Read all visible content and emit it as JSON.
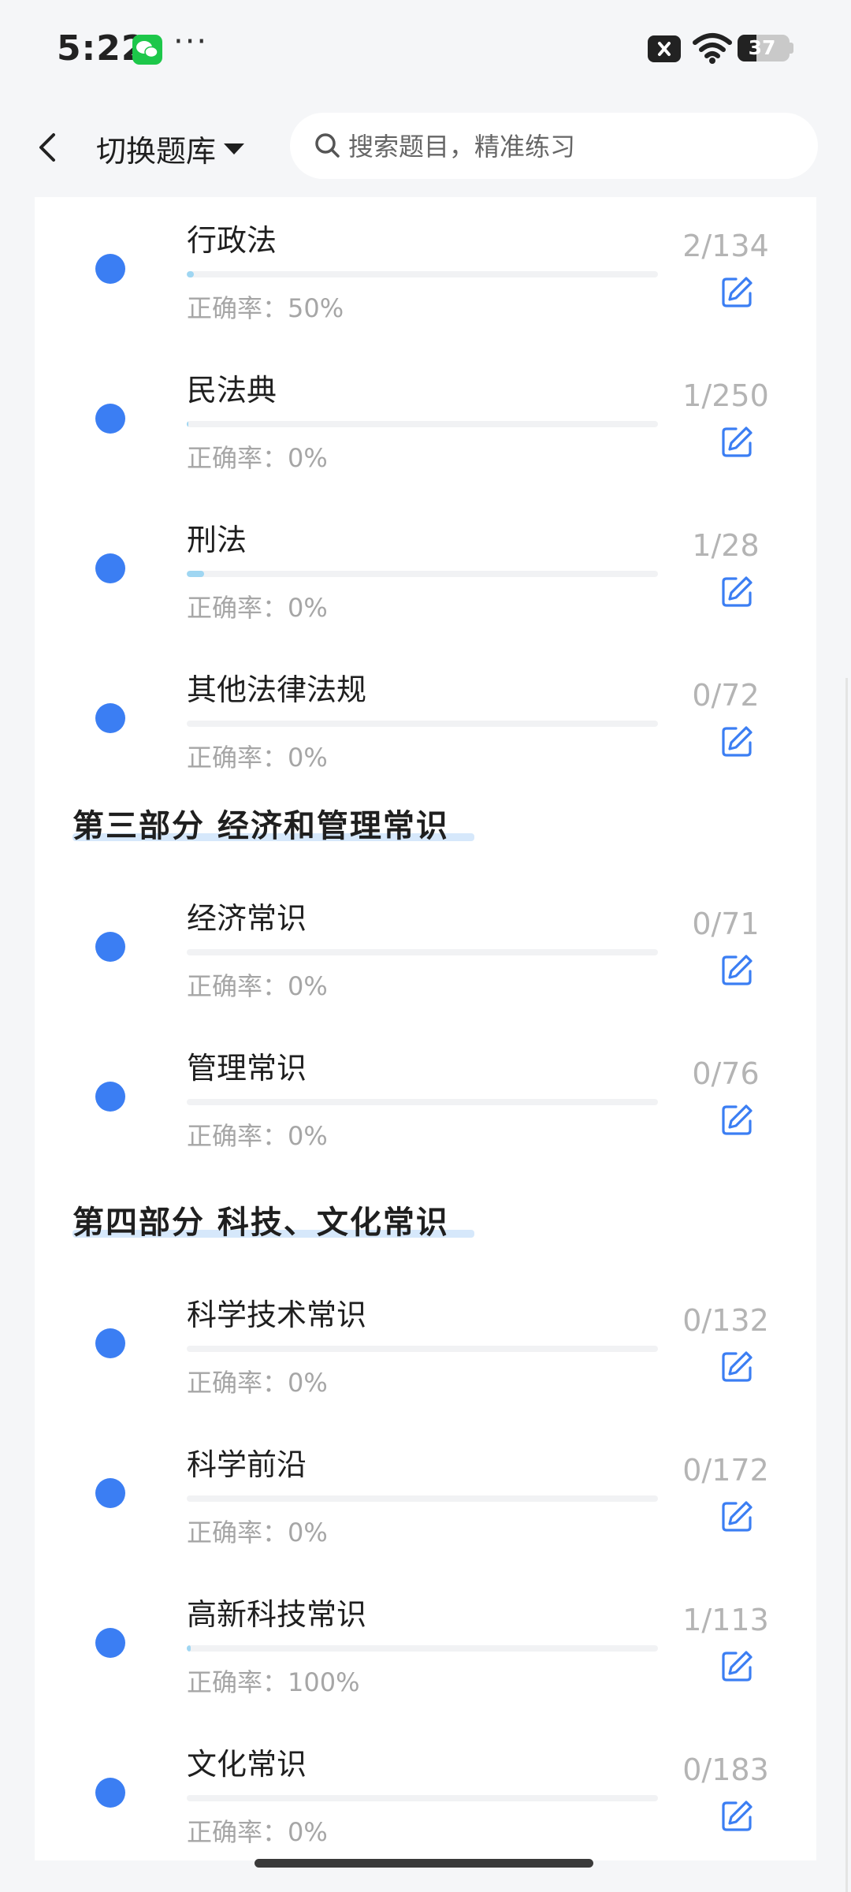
{
  "status_bar": {
    "time": "5:22",
    "more": "···",
    "battery_level": "37",
    "icons": [
      "wechat-icon",
      "sim-x-icon",
      "wifi-icon",
      "battery-icon"
    ]
  },
  "header": {
    "switch_label": "切换题库",
    "search_placeholder": "搜索题目，精准练习"
  },
  "accuracy_prefix": "正确率：",
  "colors": {
    "bullet": "#3b7ef3",
    "progress": "#9fd6f2",
    "highlight": "#d6e8fb",
    "edit_icon": "#3b7ef3"
  },
  "items_a": [
    {
      "name": "行政法",
      "count": "2/134",
      "accuracy": "50%",
      "progress": 0.015
    },
    {
      "name": "民法典",
      "count": "1/250",
      "accuracy": "0%",
      "progress": 0.004
    },
    {
      "name": "刑法",
      "count": "1/28",
      "accuracy": "0%",
      "progress": 0.036
    },
    {
      "name": "其他法律法规",
      "count": "0/72",
      "accuracy": "0%",
      "progress": 0
    }
  ],
  "section_3": {
    "title": "第三部分  经济和管理常识"
  },
  "items_b": [
    {
      "name": "经济常识",
      "count": "0/71",
      "accuracy": "0%",
      "progress": 0
    },
    {
      "name": "管理常识",
      "count": "0/76",
      "accuracy": "0%",
      "progress": 0
    }
  ],
  "section_4": {
    "title": "第四部分  科技、文化常识"
  },
  "items_c": [
    {
      "name": "科学技术常识",
      "count": "0/132",
      "accuracy": "0%",
      "progress": 0
    },
    {
      "name": "科学前沿",
      "count": "0/172",
      "accuracy": "0%",
      "progress": 0
    },
    {
      "name": "高新科技常识",
      "count": "1/113",
      "accuracy": "100%",
      "progress": 0.009
    },
    {
      "name": "文化常识",
      "count": "0/183",
      "accuracy": "0%",
      "progress": 0
    }
  ]
}
